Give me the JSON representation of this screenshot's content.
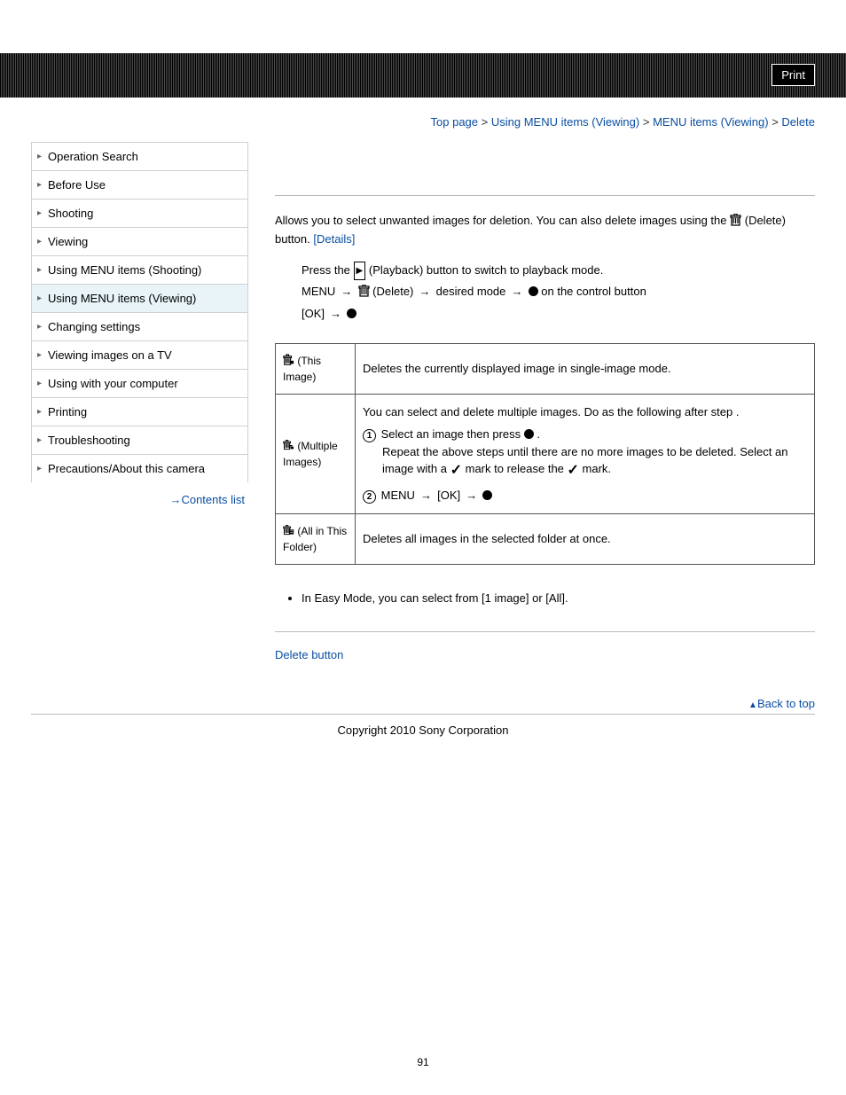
{
  "header": {
    "print": "Print"
  },
  "breadcrumb": {
    "top": "Top page",
    "l2": "Using MENU items (Viewing)",
    "l3": "MENU items (Viewing)",
    "current": "Delete"
  },
  "nav": {
    "items": [
      "Operation Search",
      "Before Use",
      "Shooting",
      "Viewing",
      "Using MENU items (Shooting)",
      "Using MENU items (Viewing)",
      "Changing settings",
      "Viewing images on a TV",
      "Using with your computer",
      "Printing",
      "Troubleshooting",
      "Precautions/About this camera"
    ],
    "active_index": 5,
    "contents": "Contents list"
  },
  "intro": {
    "text_a": "Allows you to select unwanted images for deletion. You can also delete images using the ",
    "text_b": " (Delete) button. ",
    "details": "[Details]"
  },
  "steps": {
    "s1a": "Press the ",
    "s1b": " (Playback) button to switch to playback mode.",
    "s2a": "MENU ",
    "s2b": " (Delete) ",
    "s2c": " desired mode ",
    "s2d": "  on the control button",
    "s3a": "[OK] "
  },
  "table": {
    "r1": {
      "label": " (This Image)",
      "desc": "Deletes the currently displayed image in single-image mode."
    },
    "r2": {
      "label": " (Multiple Images)",
      "line1a": "You can select and delete multiple images. Do as the following after step ",
      "line1b": ".",
      "sub1a": "Select an image then press ",
      "sub1b": " .",
      "sub1c": "Repeat the above steps until there are no more images to be deleted. Select an image with a ",
      "sub1d": " mark to release the ",
      "sub1e": " mark.",
      "sub2a": "MENU ",
      "sub2b": " [OK] "
    },
    "r3": {
      "label": " (All in This Folder)",
      "desc": "Deletes all images in the selected folder at once."
    }
  },
  "note": "In Easy Mode, you can select from [1 image] or [All].",
  "related": "Delete button",
  "backtop": "Back to top",
  "copyright": "Copyright 2010 Sony Corporation",
  "pagenum": "91"
}
